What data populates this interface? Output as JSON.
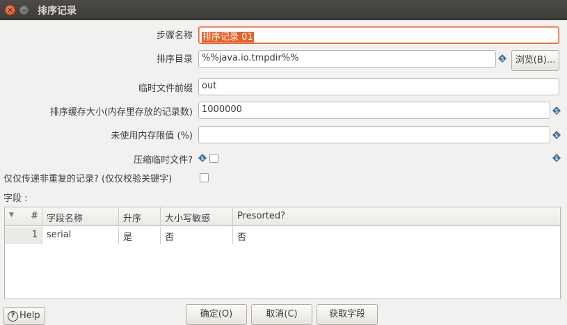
{
  "window": {
    "title": "排序记录"
  },
  "form": {
    "step_name": {
      "label": "步骤名称",
      "value_selected": "排序记录 01"
    },
    "sort_dir": {
      "label": "排序目录",
      "value": "%%java.io.tmpdir%%",
      "browse_label": "浏览(B)..."
    },
    "tmp_prefix": {
      "label": "临时文件前缀",
      "value": "out"
    },
    "sort_size": {
      "label": "排序缓存大小(内存里存放的记录数)",
      "value": "1000000"
    },
    "free_memory": {
      "label": "未使用内存限值 (%)",
      "value": ""
    },
    "compress": {
      "label": "压缩临时文件?"
    },
    "unique_rows": {
      "label": "仅仅传递非重复的记录? (仅仅校验关键字)"
    }
  },
  "fields": {
    "section_label": "字段 :",
    "columns": [
      "#",
      "字段名称",
      "升序",
      "大小写敏感",
      "Presorted?"
    ],
    "rows": [
      {
        "num": "1",
        "name": "serial",
        "ascending": "是",
        "case_sensitive": "否",
        "presorted": "否"
      }
    ]
  },
  "buttons": {
    "help": "Help",
    "ok": "确定(O)",
    "cancel": "取消(C)",
    "get_fields": "获取字段"
  },
  "colors": {
    "accent": "#e9622a",
    "var_icon": "#3d6f9e"
  }
}
